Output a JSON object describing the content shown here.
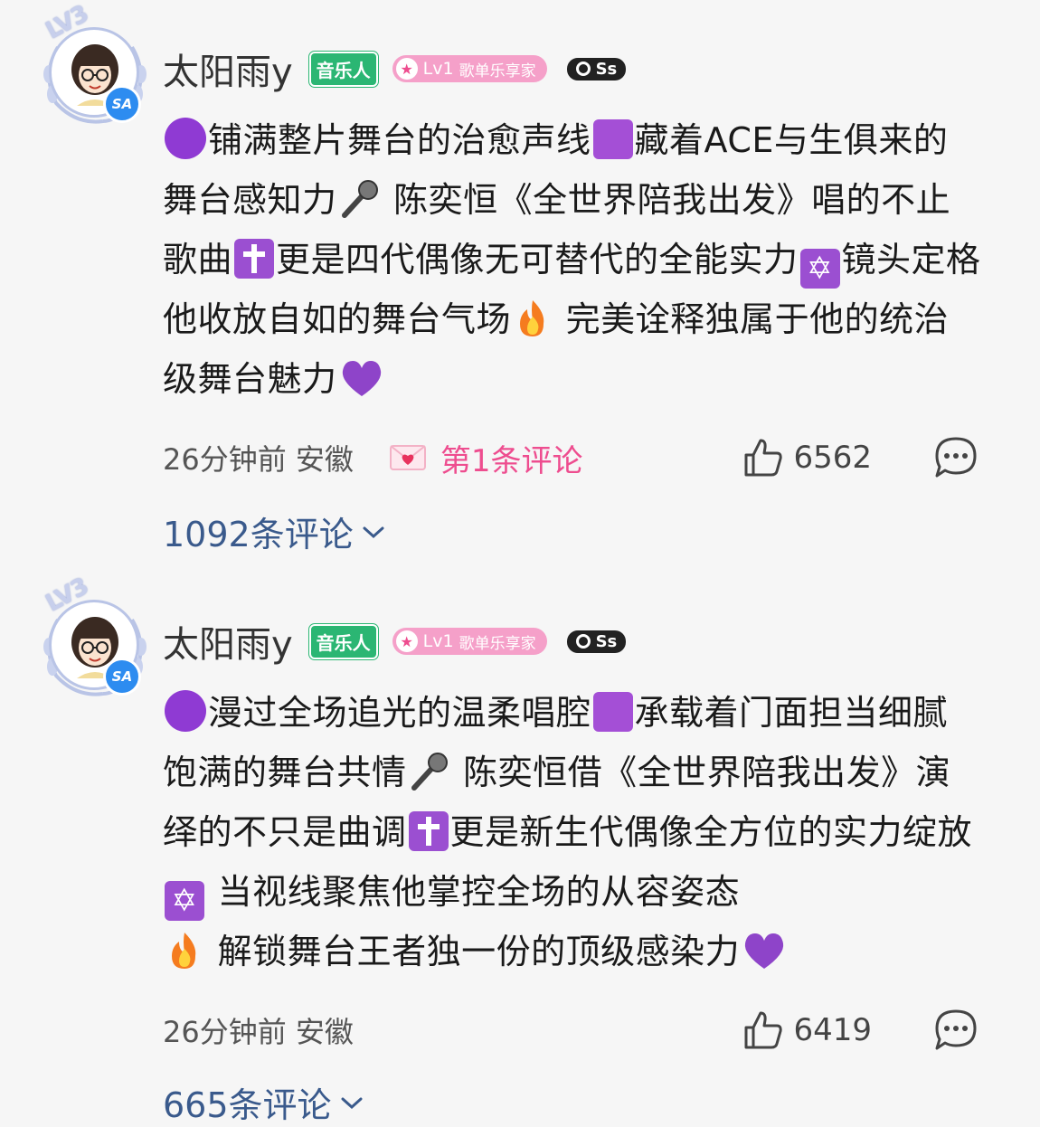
{
  "comments": [
    {
      "username": "太阳雨y",
      "level_badge": "LV3",
      "vip_badge": "SA",
      "badge_musician": "音乐人",
      "badge_lv": "Lv1",
      "badge_lv_title": "歌单乐享家",
      "badge_ss": "Ss",
      "text_segments": [
        "铺满整片舞台的治愈声线",
        "藏着ACE与生俱来的舞台感知力",
        " 陈奕恒《全世界陪我出发》唱的不止歌曲",
        "更是四代偶像无可替代的全能实力",
        "镜头定格他收放自如的舞台气场",
        " 完美诠释独属于他的统治级舞台魅力"
      ],
      "time_location": "26分钟前 安徽",
      "first_comment_label": "第1条评论",
      "likes": "6562",
      "replies": "1092条评论"
    },
    {
      "username": "太阳雨y",
      "level_badge": "LV3",
      "vip_badge": "SA",
      "badge_musician": "音乐人",
      "badge_lv": "Lv1",
      "badge_lv_title": "歌单乐享家",
      "badge_ss": "Ss",
      "text_segments": [
        "漫过全场追光的温柔唱腔",
        "承载着门面担当细腻饱满的舞台共情",
        " 陈奕恒借《全世界陪我出发》演绎的不只是曲调",
        "更是新生代偶像全方位的实力绽放",
        " 当视线聚焦他掌控全场的从容姿态",
        " 解锁舞台王者独一份的顶级感染力"
      ],
      "time_location": "26分钟前 安徽",
      "likes": "6419",
      "replies": "665条评论"
    }
  ],
  "colors": {
    "background": "#f6f6f6",
    "pink_accent": "#ee4d8f",
    "reply_link": "#3a5a8c",
    "musician_green": "#2bb673"
  },
  "icons": [
    "purple-circle-emoji",
    "purple-square-emoji",
    "microphone-emoji",
    "latin-cross-emoji",
    "star-of-david-emoji",
    "fire-emoji",
    "purple-heart-emoji",
    "love-letter-emoji",
    "thumbs-up-icon",
    "comment-bubble-icon",
    "chevron-down-icon"
  ]
}
